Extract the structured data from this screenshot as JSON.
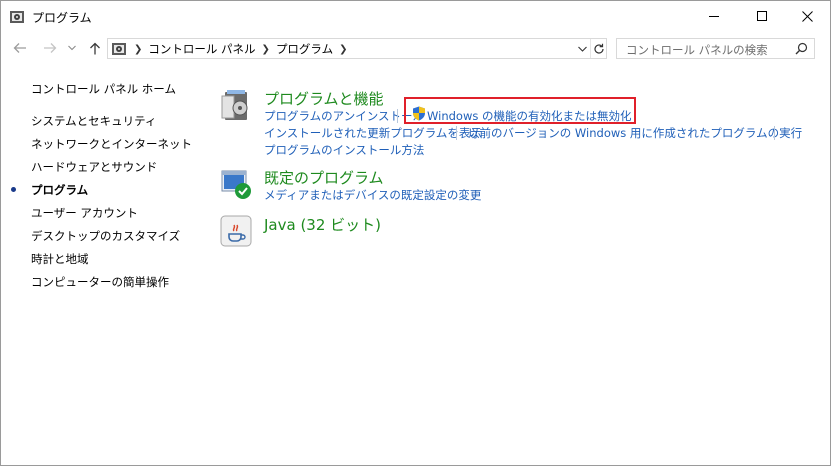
{
  "window": {
    "title": "プログラム"
  },
  "address": {
    "crumbs": [
      "コントロール パネル",
      "プログラム"
    ],
    "search_placeholder": "コントロール パネルの検索"
  },
  "sidebar": {
    "items": [
      {
        "label": "コントロール パネル ホーム",
        "current": false
      },
      {
        "label": "システムとセキュリティ",
        "current": false
      },
      {
        "label": "ネットワークとインターネット",
        "current": false
      },
      {
        "label": "ハードウェアとサウンド",
        "current": false
      },
      {
        "label": "プログラム",
        "current": true
      },
      {
        "label": "ユーザー アカウント",
        "current": false
      },
      {
        "label": "デスクトップのカスタマイズ",
        "current": false
      },
      {
        "label": "時計と地域",
        "current": false
      },
      {
        "label": "コンピューターの簡単操作",
        "current": false
      }
    ]
  },
  "main": {
    "programs": {
      "title": "プログラムと機能",
      "links": {
        "uninstall": "プログラムのアンインストール",
        "windows_features": "Windows の機能の有効化または無効化",
        "installed_updates": "インストールされた更新プログラムを表示",
        "compat": "以前のバージョンの Windows 用に作成されたプログラムの実行",
        "how_to_install": "プログラムのインストール方法"
      }
    },
    "defaults": {
      "title": "既定のプログラム",
      "links": {
        "change_defaults": "メディアまたはデバイスの既定設定の変更"
      }
    },
    "java": {
      "title": "Java (32 ビット)"
    }
  },
  "colors": {
    "link": "#1f5fb8",
    "category_title": "#1e8a1e",
    "highlight_border": "#e0202a"
  }
}
